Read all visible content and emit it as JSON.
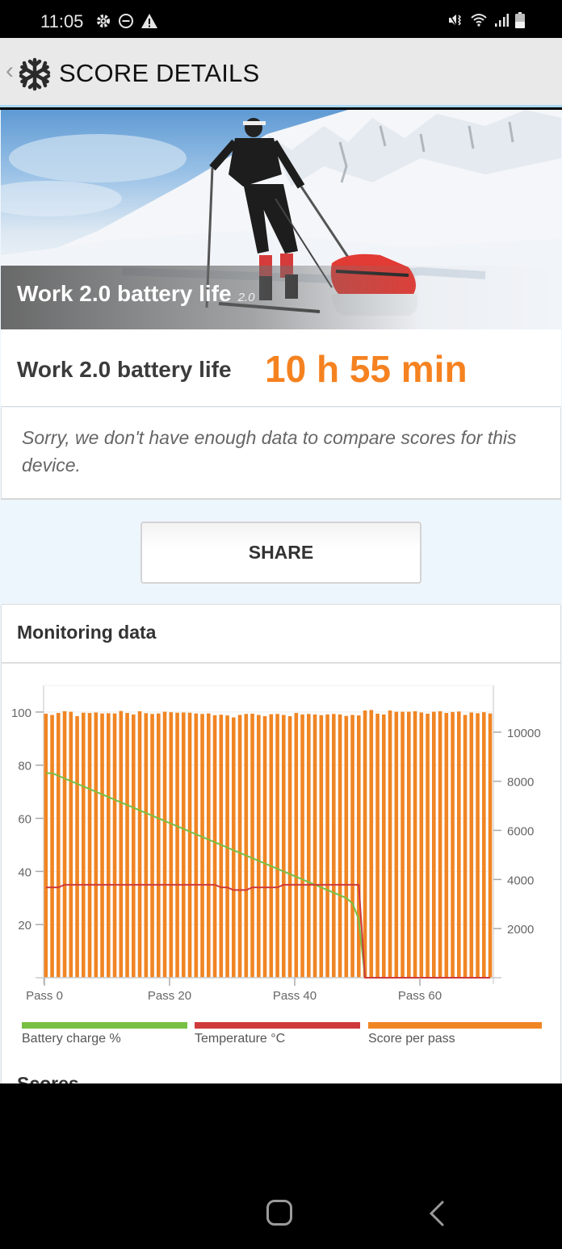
{
  "status_bar": {
    "time": "11:05",
    "left_icons": [
      "gear-icon",
      "do-not-disturb-icon",
      "warning-icon"
    ],
    "right_icons": [
      "mute-vibrate-icon",
      "wifi-icon",
      "signal-icon",
      "battery-icon"
    ]
  },
  "app_bar": {
    "title": "SCORE DETAILS",
    "back_icon": "chevron-left-icon",
    "logo_icon": "snowflake-icon"
  },
  "hero": {
    "title": "Work 2.0 battery life",
    "version": "2.0"
  },
  "score": {
    "label": "Work 2.0 battery life",
    "value": "10 h 55 min",
    "value_color": "#f58220"
  },
  "compare": {
    "message": "Sorry, we don't have enough data to compare scores for this device."
  },
  "share": {
    "label": "SHARE"
  },
  "monitoring": {
    "title": "Monitoring data",
    "next_section_peek": "Scores"
  },
  "legend": [
    {
      "label": "Battery charge %",
      "color": "#77c043"
    },
    {
      "label": "Temperature °C",
      "color": "#cf3b3c"
    },
    {
      "label": "Score per pass",
      "color": "#f08524"
    }
  ],
  "chart_data": {
    "type": "bar",
    "title": "Monitoring data",
    "xlabel": "",
    "ylabel_left": "",
    "ylabel_right": "",
    "x_ticks": [
      "Pass 0",
      "Pass 20",
      "Pass 40",
      "Pass 60"
    ],
    "x_tick_values": [
      0,
      20,
      40,
      60
    ],
    "y_left_ticks": [
      20,
      40,
      60,
      80,
      100
    ],
    "y_left_range": [
      0,
      110
    ],
    "y_right_ticks": [
      2000,
      4000,
      6000,
      8000,
      10000
    ],
    "y_right_range": [
      0,
      11900
    ],
    "grid": true,
    "legend_position": "bottom",
    "passes": 72,
    "series": [
      {
        "name": "Score per pass",
        "axis": "right",
        "kind": "bar",
        "color": "#f08524",
        "values": [
          10750,
          10700,
          10780,
          10850,
          10830,
          10650,
          10790,
          10780,
          10800,
          10760,
          10770,
          10760,
          10860,
          10780,
          10720,
          10850,
          10770,
          10740,
          10760,
          10830,
          10810,
          10790,
          10800,
          10790,
          10760,
          10740,
          10760,
          10690,
          10710,
          10680,
          10600,
          10700,
          10740,
          10750,
          10700,
          10650,
          10730,
          10740,
          10700,
          10650,
          10780,
          10720,
          10740,
          10720,
          10690,
          10720,
          10740,
          10720,
          10660,
          10700,
          10680,
          10880,
          10900,
          10750,
          10720,
          10880,
          10830,
          10830,
          10830,
          10850,
          10800,
          10750,
          10830,
          10850,
          10780,
          10820,
          10840,
          10700,
          10800,
          10770,
          10810,
          10760
        ]
      },
      {
        "name": "Battery charge %",
        "axis": "left",
        "kind": "line",
        "color": "#77c043",
        "values": [
          77,
          77,
          76,
          75,
          74,
          73,
          72,
          71,
          70,
          69,
          68,
          67,
          66,
          65,
          64,
          63,
          62,
          61,
          60,
          59,
          58,
          57,
          56,
          55,
          54,
          53,
          52,
          51,
          50,
          49,
          48,
          47,
          46,
          45,
          44,
          43,
          42,
          41,
          40,
          39,
          38,
          37,
          36,
          35,
          34,
          33,
          32,
          31,
          30,
          28,
          22,
          0,
          0,
          0,
          0,
          0,
          0,
          0,
          0,
          0,
          0,
          0,
          0,
          0,
          0,
          0,
          0,
          0,
          0,
          0,
          0,
          0
        ]
      },
      {
        "name": "Temperature °C",
        "axis": "left",
        "kind": "line",
        "color": "#cf3b3c",
        "values": [
          34,
          34,
          34,
          35,
          35,
          35,
          35,
          35,
          35,
          35,
          35,
          35,
          35,
          35,
          35,
          35,
          35,
          35,
          35,
          35,
          35,
          35,
          35,
          35,
          35,
          35,
          35,
          35,
          34,
          34,
          33,
          33,
          33,
          34,
          34,
          34,
          34,
          34,
          35,
          35,
          35,
          35,
          35,
          35,
          35,
          35,
          35,
          35,
          35,
          35,
          35,
          0,
          0,
          0,
          0,
          0,
          0,
          0,
          0,
          0,
          0,
          0,
          0,
          0,
          0,
          0,
          0,
          0,
          0,
          0,
          0,
          0
        ]
      }
    ]
  }
}
